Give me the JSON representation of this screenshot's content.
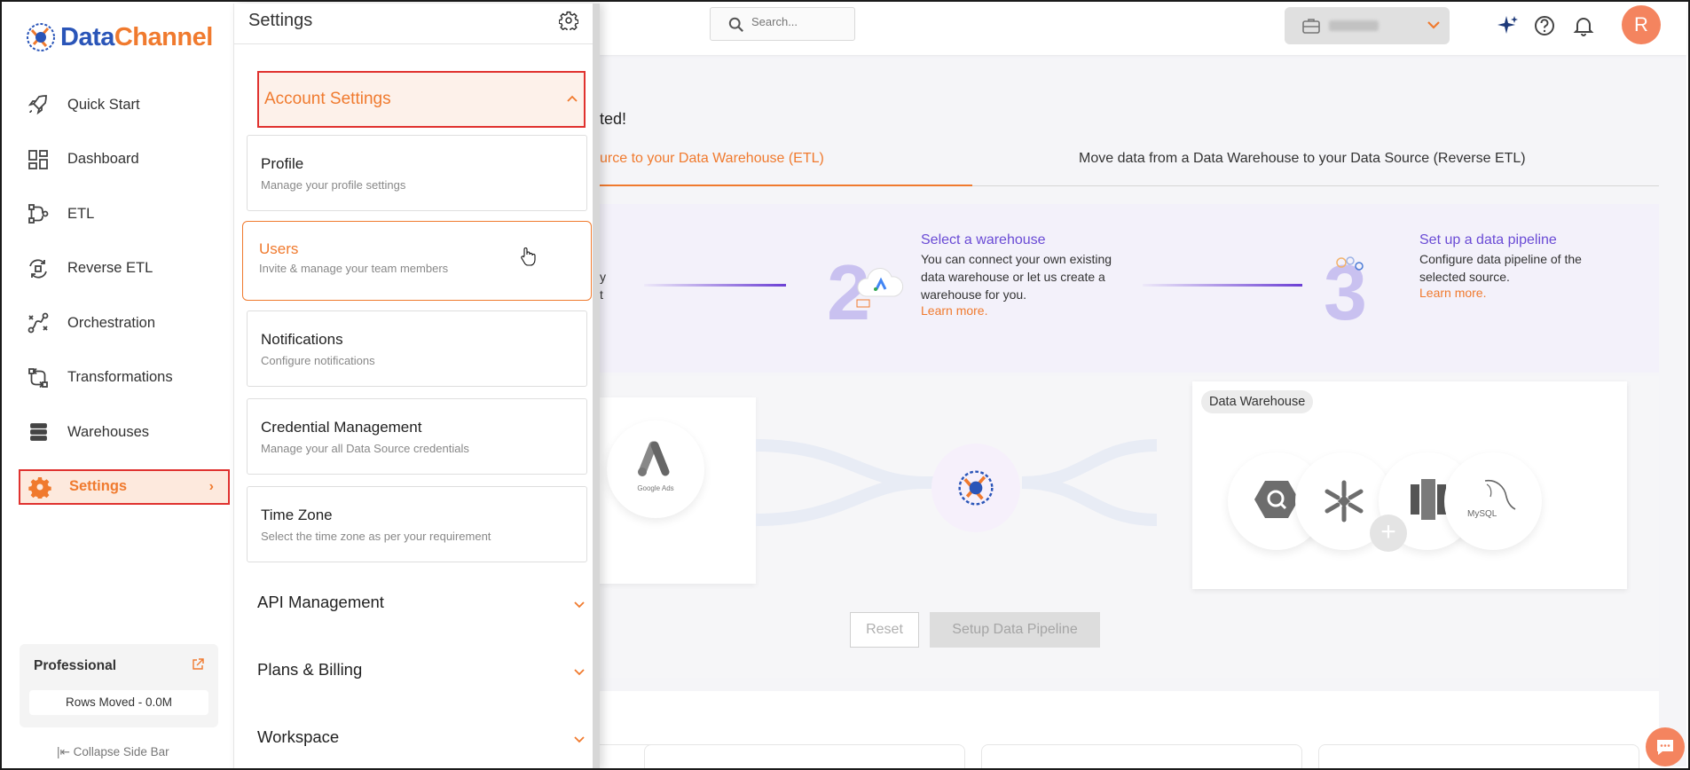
{
  "brand": {
    "name_part1": "Data",
    "name_part2": "Channel",
    "blue": "#2a55b8",
    "orange": "#f07a2e"
  },
  "sidebar": {
    "items": [
      {
        "label": "Quick Start",
        "icon": "rocket-icon"
      },
      {
        "label": "Dashboard",
        "icon": "dashboard-icon"
      },
      {
        "label": "ETL",
        "icon": "etl-icon"
      },
      {
        "label": "Reverse ETL",
        "icon": "reverse-etl-icon"
      },
      {
        "label": "Orchestration",
        "icon": "orchestration-icon"
      },
      {
        "label": "Transformations",
        "icon": "transformations-icon"
      },
      {
        "label": "Warehouses",
        "icon": "warehouses-icon"
      },
      {
        "label": "Settings",
        "icon": "gear-icon",
        "active": true
      }
    ],
    "plan": {
      "title": "Professional",
      "rows_moved": "Rows Moved - 0.0M"
    },
    "collapse_label": "Collapse Side Bar"
  },
  "settings": {
    "title": "Settings",
    "account_settings": "Account Settings",
    "cards": [
      {
        "title": "Profile",
        "desc": "Manage your profile settings"
      },
      {
        "title": "Users",
        "desc": "Invite & manage your team members",
        "highlighted": true
      },
      {
        "title": "Notifications",
        "desc": "Configure notifications"
      },
      {
        "title": "Credential Management",
        "desc": "Manage your all Data Source credentials"
      },
      {
        "title": "Time Zone",
        "desc": "Select the time zone as per your requirement"
      }
    ],
    "sections": [
      "API Management",
      "Plans & Billing",
      "Workspace"
    ]
  },
  "topbar": {
    "search_placeholder": "Search...",
    "avatar_initial": "R"
  },
  "main": {
    "banner_partial": "ted!",
    "tab_etl_partial": "urce to your Data Warehouse (ETL)",
    "tab_reverse": "Move data from a Data Warehouse to your Data Source (Reverse ETL)",
    "step1_partial": [
      "y",
      "t"
    ],
    "step2": {
      "number": "2",
      "title": "Select a warehouse",
      "desc": "You can connect your own existing data warehouse or let us create a warehouse for you.",
      "link": "Learn more."
    },
    "step3": {
      "number": "3",
      "title": "Set up a data pipeline",
      "desc": "Configure data pipeline of the selected source.",
      "link": "Learn more."
    },
    "source_logo": "Google Ads",
    "warehouse_label": "Data Warehouse",
    "warehouse_logos": [
      "bigquery-icon",
      "snowflake-icon",
      "redshift-icon",
      "mysql-icon"
    ],
    "mysql_text": "MySQL",
    "reset": "Reset",
    "setup": "Setup Data Pipeline"
  }
}
